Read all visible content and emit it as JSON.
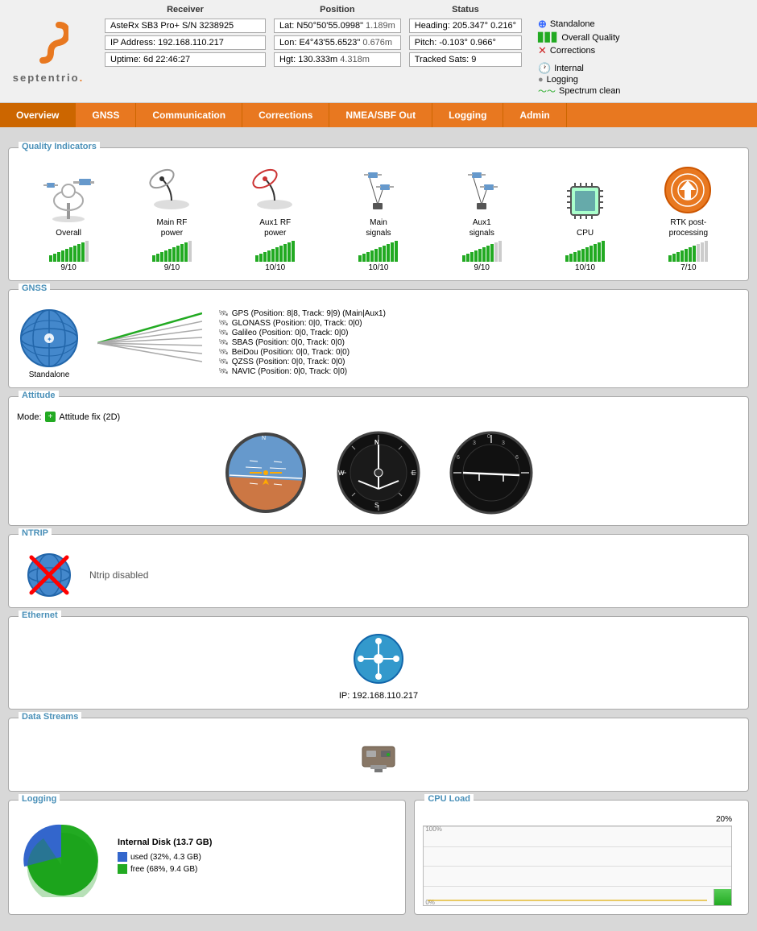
{
  "header": {
    "receiver_title": "Receiver",
    "position_title": "Position",
    "status_title": "Status",
    "receiver_model": "AsteRx SB3 Pro+ S/N 3238925",
    "ip_address": "IP Address: 192.168.110.217",
    "uptime": "Uptime: 6d 22:46:27",
    "lat": "Lat: N50°50'55.0998\"",
    "lat_err": "1.189m",
    "lon": "Lon: E4°43'55.6523\"",
    "lon_err": "0.676m",
    "hgt": "Hgt: 130.333m",
    "hgt_err": "4.318m",
    "heading": "Heading: 205.347°",
    "heading_err": "0.216°",
    "pitch": "Pitch:    -0.103°",
    "pitch_err": "0.966°",
    "tracked_sats": "Tracked Sats: 9",
    "status_standalone": "Standalone",
    "status_overall_quality": "Overall Quality",
    "status_corrections": "Corrections",
    "status_internal": "Internal",
    "status_logging": "Logging",
    "status_spectrum_clean": "Spectrum clean"
  },
  "nav": {
    "items": [
      "Overview",
      "GNSS",
      "Communication",
      "Corrections",
      "NMEA/SBF Out",
      "Logging",
      "Admin"
    ]
  },
  "quality": {
    "title": "Quality Indicators",
    "items": [
      {
        "label": "Overall",
        "score": "9/10",
        "filled": 9,
        "total": 10
      },
      {
        "label": "Main RF\npower",
        "score": "9/10",
        "filled": 9,
        "total": 10
      },
      {
        "label": "Aux1 RF\npower",
        "score": "10/10",
        "filled": 10,
        "total": 10
      },
      {
        "label": "Main\nsignals",
        "score": "10/10",
        "filled": 10,
        "total": 10
      },
      {
        "label": "Aux1\nsignals",
        "score": "9/10",
        "filled": 9,
        "total": 10
      },
      {
        "label": "CPU",
        "score": "10/10",
        "filled": 10,
        "total": 10
      },
      {
        "label": "RTK post-\nprocessing",
        "score": "7/10",
        "filled": 7,
        "total": 10
      }
    ]
  },
  "gnss": {
    "title": "GNSS",
    "standalone_label": "Standalone",
    "satellites": [
      "GPS (Position: 8|8, Track: 9|9) (Main|Aux1)",
      "GLONASS (Position: 0|0, Track: 0|0)",
      "Galileo (Position: 0|0, Track: 0|0)",
      "SBAS (Position: 0|0, Track: 0|0)",
      "BeiDou (Position: 0|0, Track: 0|0)",
      "QZSS (Position: 0|0, Track: 0|0)",
      "NAVIC (Position: 0|0, Track: 0|0)"
    ]
  },
  "attitude": {
    "title": "Attitude",
    "mode_label": "Mode:",
    "mode_value": "Attitude fix (2D)"
  },
  "ntrip": {
    "title": "NTRIP",
    "disabled_text": "Ntrip disabled"
  },
  "ethernet": {
    "title": "Ethernet",
    "ip_label": "IP: 192.168.110.217"
  },
  "datastreams": {
    "title": "Data Streams"
  },
  "logging": {
    "title": "Logging",
    "disk_label": "Internal Disk (13.7 GB)",
    "used_label": "used (32%, 4.3 GB)",
    "free_label": "free (68%, 9.4 GB)"
  },
  "cpuload": {
    "title": "CPU Load",
    "value": "20%",
    "max_label": "100%",
    "min_label": "0%"
  }
}
